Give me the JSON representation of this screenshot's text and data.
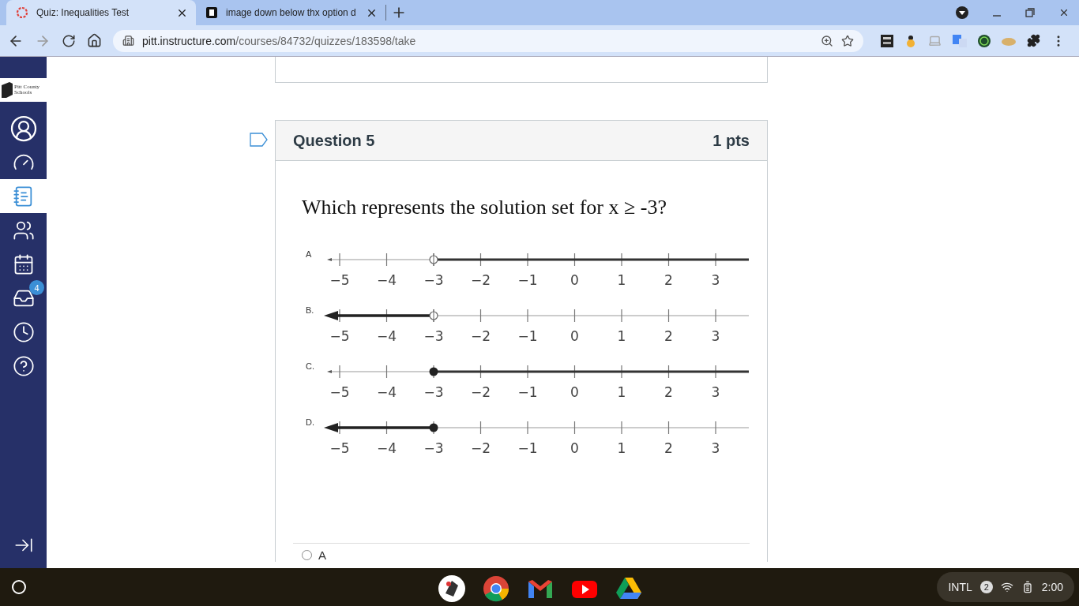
{
  "browser": {
    "tabs": [
      {
        "title": "Quiz: Inequalities Test",
        "selected": true
      },
      {
        "title": "image down below thx option d",
        "selected": false
      }
    ],
    "url": {
      "host": "pitt.instructure.com",
      "path": "/courses/84732/quizzes/183598/take"
    }
  },
  "sidebar": {
    "logo": [
      "Pitt County",
      "Schools"
    ],
    "items": [
      {
        "kind": "account",
        "selected": false
      },
      {
        "kind": "dashboard",
        "selected": false
      },
      {
        "kind": "courses",
        "selected": true
      },
      {
        "kind": "groups",
        "selected": false
      },
      {
        "kind": "calendar",
        "selected": false
      },
      {
        "kind": "inbox",
        "selected": false,
        "badge": "4"
      },
      {
        "kind": "history",
        "selected": false
      },
      {
        "kind": "help",
        "selected": false
      }
    ]
  },
  "question": {
    "title": "Question 5",
    "points": "1 pts",
    "text": "Which represents the solution set for x ≥ -3?",
    "number_lines": [
      {
        "label": "A",
        "filled": false,
        "shaded_right": true,
        "ticks": [
          "−5",
          "−4",
          "−3",
          "−2",
          "−1",
          "0",
          "1",
          "2",
          "3"
        ]
      },
      {
        "label": "B.",
        "filled": false,
        "shaded_right": false,
        "ticks": [
          "−5",
          "−4",
          "−3",
          "−2",
          "−1",
          "0",
          "1",
          "2",
          "3"
        ]
      },
      {
        "label": "C.",
        "filled": true,
        "shaded_right": true,
        "ticks": [
          "−5",
          "−4",
          "−3",
          "−2",
          "−1",
          "0",
          "1",
          "2",
          "3"
        ]
      },
      {
        "label": "D.",
        "filled": true,
        "shaded_right": false,
        "ticks": [
          "−5",
          "−4",
          "−3",
          "−2",
          "−1",
          "0",
          "1",
          "2",
          "3"
        ]
      }
    ],
    "answers": [
      {
        "label": "A",
        "selected": false
      }
    ]
  },
  "taskbar": {
    "tray": {
      "keyboard": "INTL",
      "notifications": "2",
      "time": "2:00"
    }
  }
}
